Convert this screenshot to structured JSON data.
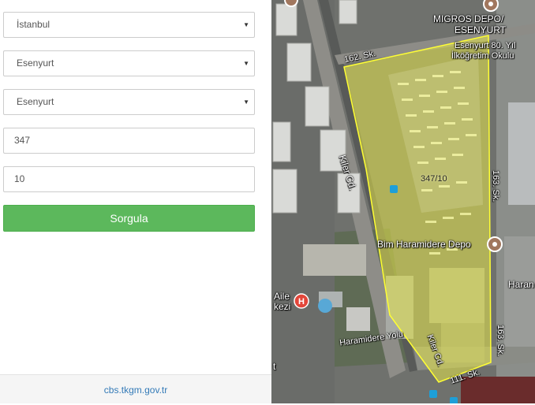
{
  "form": {
    "province": "İstanbul",
    "district": "Esenyurt",
    "neighborhood": "Esenyurt",
    "block": "347",
    "parcel": "10",
    "submit_label": "Sorgula"
  },
  "footer": {
    "link": "cbs.tkgm.gov.tr"
  },
  "map": {
    "parcel_label": "347/10",
    "places": {
      "migros_line1": "MIGROS DEPO/",
      "migros_line2": "ESENYURT",
      "school_line1": "Esenyurt 80. Yıl",
      "school_line2": "İlköğretim Okulu",
      "bim": "Bim Haramidere Depo",
      "hospital_line1": "Aile",
      "hospital_line2": "kezi",
      "haram_partial": "Haran",
      "t_partial": "t"
    },
    "streets": {
      "s162": "162. Sk.",
      "s163a": "163. Sk.",
      "s163b": "163. Sk.",
      "kiler_a": "Kiler Cd.",
      "kiler_b": "Kiler Cd.",
      "haramidere": "Haramidere Yolu",
      "s111": "111. Sk."
    },
    "colors": {
      "parcel_fill": "#e6e64a",
      "parcel_stroke": "#ffff33",
      "poi": "#a1775e",
      "hospital": "#e2463a"
    }
  }
}
